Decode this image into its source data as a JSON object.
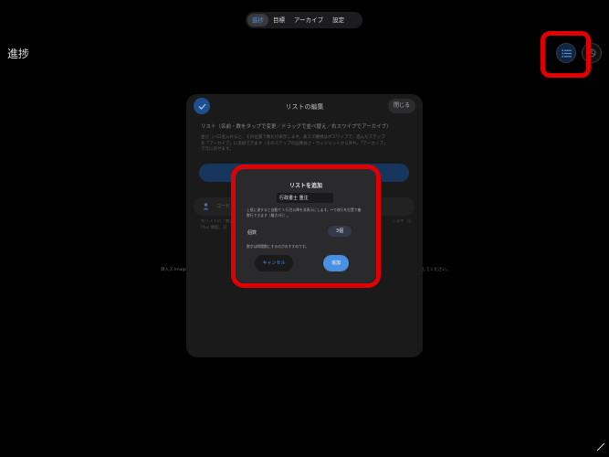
{
  "tabs": [
    {
      "label": "進捗",
      "active": true
    },
    {
      "label": "目標",
      "active": false
    },
    {
      "label": "アーカイブ",
      "active": false
    },
    {
      "label": "設定",
      "active": false
    }
  ],
  "page_title": "進捗",
  "top_right_buttons": {
    "list_icon": "list-icon",
    "chart_icon": "chart-icon"
  },
  "background_texts": {
    "left": "目入ス Image",
    "right": "してください。"
  },
  "sheet": {
    "title": "リストの編集",
    "close_label": "閉じる",
    "subtitle": "リスト（名前・数をタップで変更／ドラッグで並べ替え／右スワイプでアーカイブ）",
    "description": "並び（ハロ名入れると、その位置で数だけ表示します。表スズ機視はボスワイプで、進んだステップ\nを「アーカイブ」に追加できます（そのステップの画像長さ・ウィジェットから外れ、「アーカイブ」\nで元に戻せます。",
    "row_text": "コード",
    "note": "各リストの「数」を                                                                                                                      します（前年日\nPlus 機能。前"
  },
  "dialog": {
    "title": "リストを追加",
    "input_value": "行政書士 重注",
    "help_text": "上限に達すると自動で 3 行目以降を非表示にします。↩で改行を位置で複\n数行できます（最大3行）。",
    "count_label": "個数",
    "count_value": "3個",
    "note": "数字は問題数にするのがおすすめです。",
    "cancel_label": "キャンセル",
    "add_label": "追加"
  },
  "colors": {
    "accent": "#4a90e2",
    "highlight": "#e00000",
    "background": "#000000"
  }
}
